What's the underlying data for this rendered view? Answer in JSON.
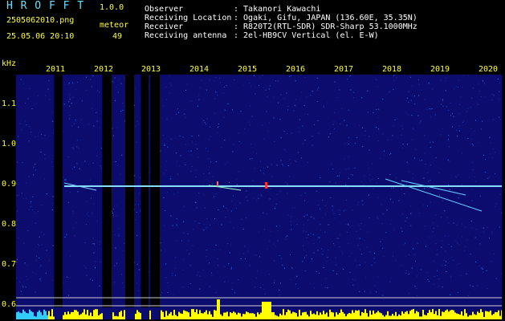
{
  "app": {
    "logo": "H R O F F T",
    "version": "1.0.0",
    "filename": "2505062010.png",
    "datetime": "25.05.06 20:10",
    "meteor_label": "meteor",
    "meteor_count": "49"
  },
  "info": {
    "observer_label": "Observer",
    "observer_value": ": Takanori Kawachi",
    "location_label": "Receiving Location",
    "location_value": ": Ogaki, Gifu, JAPAN (136.60E, 35.35N)",
    "receiver_label": "Receiver",
    "receiver_value": ": R820T2(RTL-SDR) SDR-Sharp 53.1000MHz",
    "antenna_label": "Receiving antenna",
    "antenna_value": ": 2el-HB9CV Vertical (el. E-W)"
  },
  "axis": {
    "y_unit": "kHz",
    "x_ticks": [
      "2011",
      "2012",
      "2013",
      "2014",
      "2015",
      "2016",
      "2017",
      "2018",
      "2019",
      "2020"
    ],
    "y_ticks": [
      "1.1",
      "1.0",
      "0.9",
      "0.8",
      "0.7",
      "0.6"
    ]
  },
  "colors": {
    "background": "#0a0a6a",
    "signal": "#88ddff",
    "bars": "#000000",
    "histogram": "#ffff00",
    "histogram_low": "#33ccff"
  }
}
